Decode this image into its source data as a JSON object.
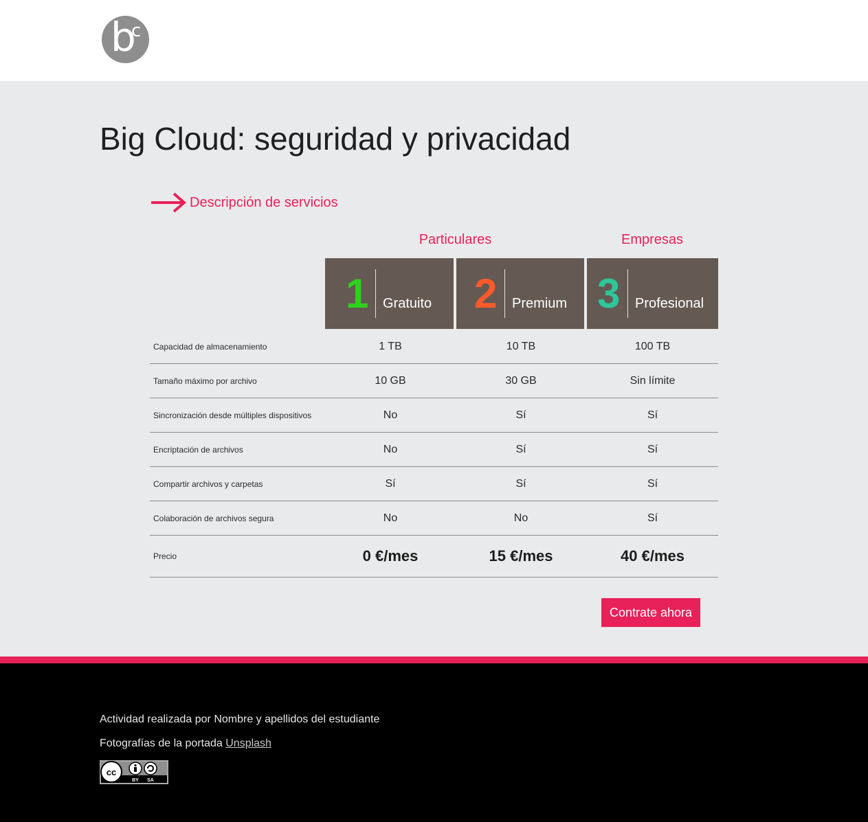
{
  "brand": {
    "logo_main": "b",
    "logo_super": "c"
  },
  "page": {
    "title": "Big Cloud: seguridad y privacidad"
  },
  "section": {
    "link_label": "Descripción de servicios"
  },
  "groups": {
    "individuals": "Particulares",
    "business": "Empresas"
  },
  "plans": [
    {
      "number": "1",
      "name": "Gratuito",
      "number_color": "#2fd01d"
    },
    {
      "number": "2",
      "name": "Premium",
      "number_color": "#ff5a2a"
    },
    {
      "number": "3",
      "name": "Profesional",
      "number_color": "#2ec69a"
    }
  ],
  "rows": [
    {
      "label": "Capacidad de almacenamiento",
      "values": [
        "1 TB",
        "10 TB",
        "100 TB"
      ]
    },
    {
      "label": "Tamaño máximo por archivo",
      "values": [
        "10 GB",
        "30 GB",
        "Sin límite"
      ]
    },
    {
      "label": "Sincronización desde múltiples dispositivos",
      "values": [
        "No",
        "Sí",
        "Sí"
      ]
    },
    {
      "label": "Encriptación de archivos",
      "values": [
        "No",
        "Sí",
        "Sí"
      ]
    },
    {
      "label": "Compartir archivos y carpetas",
      "values": [
        "Sí",
        "Sí",
        "Sí"
      ]
    },
    {
      "label": "Colaboración de archivos segura",
      "values": [
        "No",
        "No",
        "Sí"
      ]
    },
    {
      "label": "Precio",
      "values": [
        "0 €/mes",
        "15 €/mes",
        "40 €/mes"
      ]
    }
  ],
  "cta": {
    "label": "Contrate ahora"
  },
  "footer": {
    "credit": "Actividad realizada por Nombre y apellidos del estudiante",
    "photos_prefix": "Fotografías de la portada",
    "photos_link": "Unsplash",
    "license_cc": "cc",
    "license_by": "BY",
    "license_sa": "SA"
  },
  "colors": {
    "accent": "#e8215a",
    "plan_header_bg": "#645a53",
    "footer_bg": "#000000",
    "page_bg": "#e9eaeb"
  }
}
